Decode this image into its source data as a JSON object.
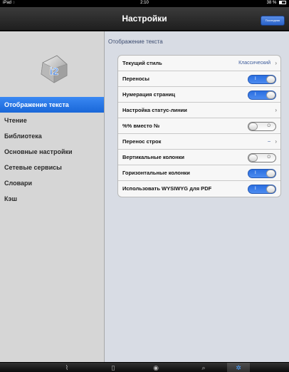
{
  "status_bar": {
    "device": "iPad",
    "wifi_icon": "wifi-icon",
    "time": "2:10",
    "battery": "38 %"
  },
  "nav": {
    "title": "Настройки",
    "right_button": "Последняя"
  },
  "sidebar": {
    "logo_text": "i2",
    "items": [
      {
        "label": "Отображение текста",
        "selected": true
      },
      {
        "label": "Чтение",
        "selected": false
      },
      {
        "label": "Библиотека",
        "selected": false
      },
      {
        "label": "Основные настройки",
        "selected": false
      },
      {
        "label": "Сетевые сервисы",
        "selected": false
      },
      {
        "label": "Словари",
        "selected": false
      },
      {
        "label": "Кэш",
        "selected": false
      }
    ]
  },
  "content": {
    "section_title": "Отображение текста",
    "rows": [
      {
        "label": "Текущий стиль",
        "type": "link",
        "value": "Классический"
      },
      {
        "label": "Переносы",
        "type": "toggle",
        "on": true
      },
      {
        "label": "Нумерация страниц",
        "type": "toggle",
        "on": true
      },
      {
        "label": "Настройка статус-линии",
        "type": "link",
        "value": ""
      },
      {
        "label": "%% вместо №",
        "type": "toggle",
        "on": false
      },
      {
        "label": "Перенос строк",
        "type": "link",
        "value": "–"
      },
      {
        "label": "Вертикальные колонки",
        "type": "toggle",
        "on": false
      },
      {
        "label": "Горизонтальные колонки",
        "type": "toggle",
        "on": true
      },
      {
        "label": "Использовать WYSIWYG для PDF",
        "type": "toggle",
        "on": true
      }
    ],
    "toggle_on_mark": "I",
    "toggle_off_mark": "O"
  },
  "tabbar": {
    "tabs": [
      {
        "icon": "bookshelf-icon",
        "active": false
      },
      {
        "icon": "book-icon",
        "active": false
      },
      {
        "icon": "globe-icon",
        "active": false
      },
      {
        "icon": "search-icon",
        "active": false
      },
      {
        "icon": "gear-icon",
        "active": true
      }
    ]
  },
  "colors": {
    "accent": "#1967d8",
    "toggle_on": "#2a6ee0",
    "sidebar_bg": "#d6d6d6",
    "content_bg": "#d8dce4"
  }
}
